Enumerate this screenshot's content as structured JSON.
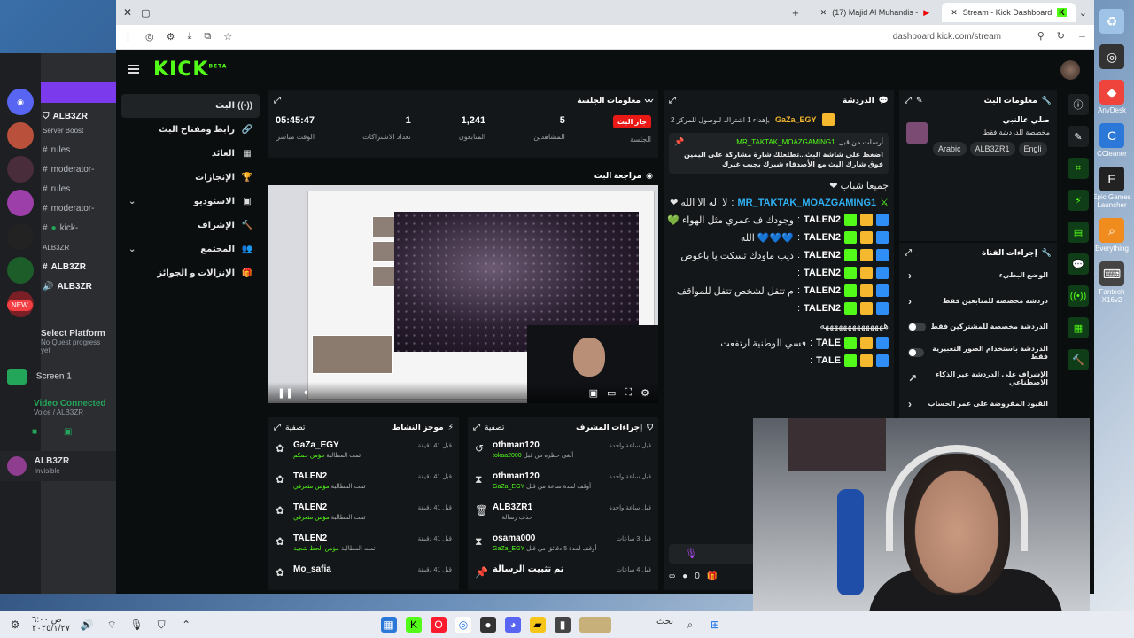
{
  "browser": {
    "tabs": [
      {
        "label": "(17) Majid Al Muhandis -"
      },
      {
        "label": "Stream - Kick Dashboard"
      }
    ],
    "url": "dashboard.kick.com/stream"
  },
  "discord": {
    "server_name": "ALB3ZR",
    "server_sub": "Server Boost",
    "channels": [
      "rules",
      "moderator-",
      "rules",
      "moderator-",
      "kick-",
      "ALB3ZR",
      "ALB3ZR",
      "ALB3ZR"
    ],
    "new_badge": "NEW",
    "quest_title": "Select Platform",
    "quest_sub": "No Quest progress yet",
    "screen_label": "Screen 1",
    "voice_status": "Video Connected",
    "voice_sub": "Voice / ALB3ZR",
    "user_name": "ALB3ZR",
    "user_status": "Invisible"
  },
  "kick": {
    "logo": "KICK",
    "logo_sup": "BETA",
    "nav": [
      {
        "label": "البث",
        "icon": "((•))"
      },
      {
        "label": "رابط ومفتاح البث",
        "icon": "🔗"
      },
      {
        "label": "العائد",
        "icon": "▦"
      },
      {
        "label": "الإنجازات",
        "icon": "🏆"
      },
      {
        "label": "الاستوديو",
        "icon": "▣"
      },
      {
        "label": "الإشراف",
        "icon": "🔨"
      },
      {
        "label": "المجتمع",
        "icon": "👥"
      },
      {
        "label": "الإنزالات و الجوائز",
        "icon": "🎁"
      }
    ],
    "session": {
      "title": "معلومات الجلسة",
      "stats": [
        {
          "value": "05:45:47",
          "label": "الوقت مباشر"
        },
        {
          "value": "1",
          "label": "تعداد الاشتراكات"
        },
        {
          "value": "1,241",
          "label": "المتابعون"
        },
        {
          "value": "5",
          "label": "المشاهدين"
        },
        {
          "value": "جار البث",
          "label": "الجلسة"
        }
      ]
    },
    "preview": {
      "title": "مراجعة البث"
    },
    "chat": {
      "title": "الدردشة",
      "top_user": "GaZa_EGY",
      "top_msg": "بإهداء 1 اشتراك للوصول للمركز 2",
      "pinned_by": "أرسلت من قبل",
      "pinned_user": "MR_TAKTAK_MOAZGAMING1",
      "pinned_text": "اضغط على شاشة البث...تطلعلك شارة مشاركة على اليمين فوق شارك البث مع الأصدقاء شيرك يجيب غيرك",
      "messages": [
        {
          "user": "",
          "text": "جميعا شباب ❤"
        },
        {
          "user": "MR_TAKTAK_MOAZGAMING1",
          "text": "لا اله الا الله ❤"
        },
        {
          "user": "TALEN2",
          "text": "وجودك ف عمري مثل الهواء 💚"
        },
        {
          "user": "TALEN2",
          "text": "💙💙💙 الله"
        },
        {
          "user": "TALEN2",
          "text": "ذيب ماودك تسكت يا باعوص"
        },
        {
          "user": "TALEN2",
          "text": ""
        },
        {
          "user": "TALEN2",
          "text": "م تتفل لشخص تتفل للمواقف"
        },
        {
          "user": "TALEN2",
          "text": ""
        },
        {
          "user": "",
          "text": "ههههههههههههههه"
        },
        {
          "user": "TALE",
          "text": "فسي الوطنية ارتفعت"
        },
        {
          "user": "TALE",
          "text": ""
        }
      ],
      "count": "0"
    },
    "activity": {
      "title": "موجز النشاط",
      "filter": "تصفية",
      "rows": [
        {
          "name": "GaZa_EGY",
          "sub_a": "تمت المطالبة",
          "sub_b": "مؤمن حمكم",
          "time": "قبل 41 دقيقة"
        },
        {
          "name": "TALEN2",
          "sub_a": "تمت المطالبة",
          "sub_b": "مؤمن متعرفي",
          "time": "قبل 41 دقيقة"
        },
        {
          "name": "TALEN2",
          "sub_a": "تمت المطالبة",
          "sub_b": "مؤمن متعرفي",
          "time": "قبل 41 دقيقة"
        },
        {
          "name": "TALEN2",
          "sub_a": "تمت المطالبة",
          "sub_b": "مؤمن الحظ شجية",
          "time": "قبل 41 دقيقة"
        },
        {
          "name": "Mo_safia",
          "sub_a": "",
          "sub_b": "",
          "time": "قبل 41 دقيقة"
        }
      ]
    },
    "mod": {
      "title": "إجراءات المشرف",
      "filter": "تصفية",
      "rows": [
        {
          "name": "othman120",
          "sub_a": "ألغى حظره من قبل",
          "sub_b": "tokaa2000",
          "time": "قبل ساعة واحدة",
          "icon": "↺"
        },
        {
          "name": "othman120",
          "sub_a": "أوقف لمدة ساعة من قبل",
          "sub_b": "GaZa_EGY",
          "time": "قبل ساعة واحدة",
          "icon": "⧗"
        },
        {
          "name": "ALB3ZR1",
          "sub_a": "حذف رسالة",
          "sub_b": "",
          "time": "قبل ساعة واحدة",
          "icon": "🗑"
        },
        {
          "name": "osama000",
          "sub_a": "أوقف لمدة 5 دقائق من قبل",
          "sub_b": "GaZa_EGY",
          "time": "قبل 3 ساعات",
          "icon": "⧗"
        },
        {
          "name": "تم تثبيت الرسالة",
          "sub_a": "",
          "sub_b": "",
          "time": "قبل 4 ساعات",
          "icon": "📌"
        }
      ]
    },
    "stream_info": {
      "title": "معلومات البث",
      "stream_title": "صلي عالنبي",
      "stream_sub": "مخصصة للدردشة فقط",
      "tags": [
        "Arabic",
        "ALB3ZR1",
        "Engli"
      ]
    },
    "quick": {
      "title": "إجراءات القناة",
      "rows": [
        {
          "label": "الوضع البطيء",
          "kind": "chev"
        },
        {
          "label": "دردشة مخصصة للمتابعين فقط",
          "kind": "chev"
        },
        {
          "label": "الدردشة مخصصة للمشتركين فقط",
          "kind": "toggle"
        },
        {
          "label": "الدردشة باستخدام الصور التعبيرية فقط",
          "kind": "toggle"
        },
        {
          "label": "الإشراف على الدردشة عبر الذكاء الاصطناعي",
          "kind": "ext"
        },
        {
          "label": "القيود المفروضة على عمر الحساب",
          "kind": "chev"
        }
      ]
    }
  },
  "desktop_icons": [
    {
      "label": "AnyDesk",
      "color": "#ef443b"
    },
    {
      "label": "CCleaner",
      "color": "#2b78d8"
    },
    {
      "label": "Epic Games Launcher",
      "color": "#222222"
    },
    {
      "label": "Everything",
      "color": "#f08b1e"
    },
    {
      "label": "Fantech X16v2",
      "color": "#444444"
    }
  ],
  "taskbar": {
    "time": "ص ٦:٠٠",
    "date": "٢٠٢٥/١/٢٧",
    "search_label": "بحث"
  }
}
